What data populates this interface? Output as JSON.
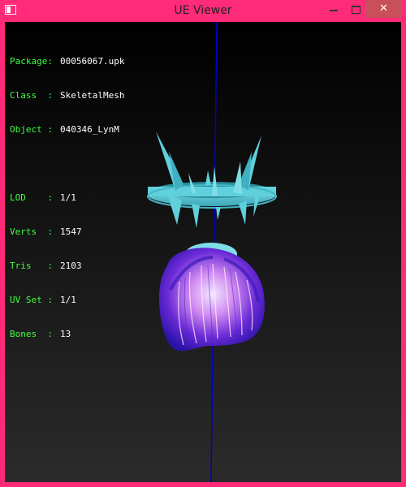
{
  "window": {
    "title": "UE Viewer",
    "controls": {
      "minimize": "minimize-button",
      "maximize": "maximize-button",
      "close": "close-button"
    }
  },
  "info": {
    "package_label": "Package:",
    "package_value": "00056067.upk",
    "class_label": "Class  :",
    "class_value": "SkeletalMesh",
    "object_label": "Object :",
    "object_value": "040346_LynM",
    "lod_label": "LOD    :",
    "lod_value": "1/1",
    "verts_label": "Verts  :",
    "verts_value": "1547",
    "tris_label": "Tris   :",
    "tris_value": "2103",
    "uvset_label": "UV Set :",
    "uvset_value": "1/1",
    "bones_label": "Bones  :",
    "bones_value": "13"
  },
  "colors": {
    "frame": "#ff2a78",
    "label_green": "#3fff3f",
    "axis_blue": "#0000cc",
    "crown_cyan": "#5fd0dc",
    "hair_purple": "#6a2ad6"
  }
}
